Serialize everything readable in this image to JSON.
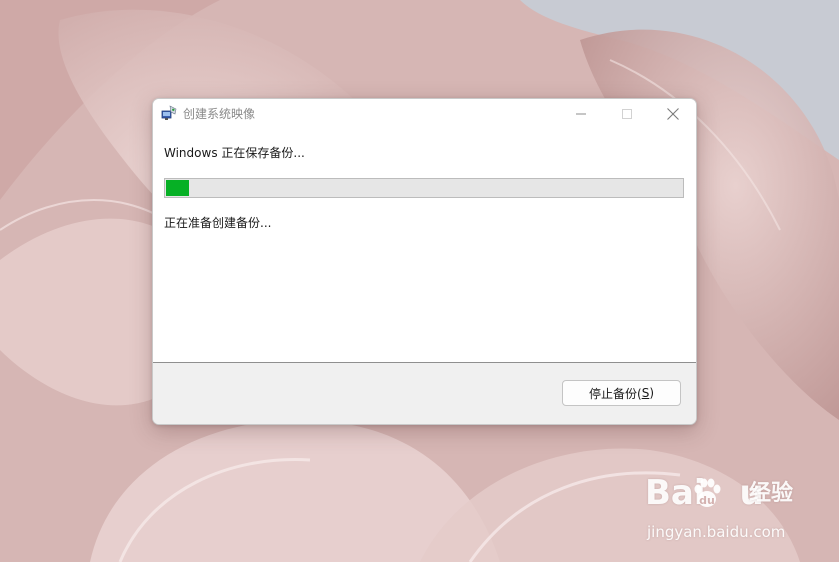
{
  "window": {
    "title": "创建系统映像",
    "icon": "backup-app-icon"
  },
  "content": {
    "status_main": "Windows 正在保存备份...",
    "progress_fraction": 0.045,
    "progress_color": "#06b025",
    "status_sub": "正在准备创建备份..."
  },
  "footer": {
    "stop_label": "停止备份(",
    "stop_accel": "S",
    "stop_label_end": ")"
  },
  "watermark": {
    "brand_left": "Bai",
    "brand_right": "u",
    "product": "经验",
    "url": "jingyan.baidu.com"
  },
  "colors": {
    "desktop_bg": "#d8b8b6",
    "accent_green": "#06b025"
  }
}
